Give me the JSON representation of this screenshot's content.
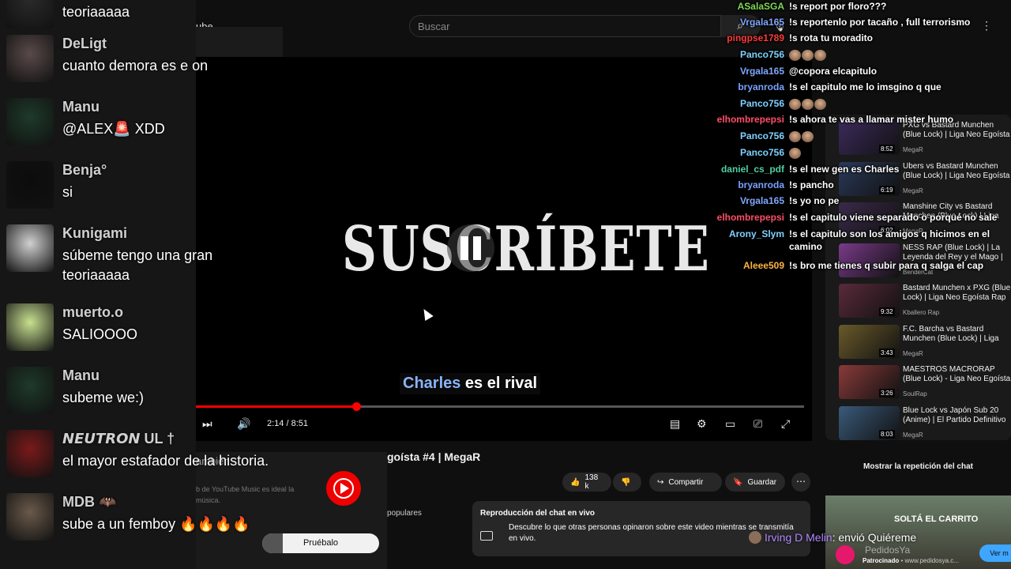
{
  "youtube": {
    "logo_suffix": "ube",
    "search_placeholder": "Buscar",
    "video_title": "goísta #4 | MegaR",
    "time": "2:14 / 8:51",
    "progress_fraction": 0.264,
    "caption_highlight": "Charles",
    "caption_rest": " es el rival",
    "overlay_title": "SUSCRÍBETE",
    "actions": {
      "likes": "138 k",
      "share": "Compartir",
      "save": "Guardar"
    },
    "chip_popular": "populares",
    "live_chat": {
      "title": "Reproducción del chat en vivo",
      "desc": "Descubre lo que otras personas opinaron sobre este video mientras se transmitía en vivo."
    },
    "promo": {
      "text": "ambién",
      "small": "b de YouTube Music es ideal la música.",
      "button": "Pruébalo"
    },
    "related": [
      {
        "title": "PXG vs Bastard Munchen (Blue Lock) | Liga Neo Egoísta #4 |",
        "channel": "MegaR",
        "duration": "8:52",
        "color": "#3b2a5a"
      },
      {
        "title": "Ubers vs Bastard Munchen (Blue Lock) | Liga Neo Egoísta",
        "channel": "MegaR",
        "duration": "6:19",
        "color": "#2a3a5a"
      },
      {
        "title": "Manshine City vs Bastard Munchen (Blue Lock) | Liga",
        "channel": "MegaR",
        "duration": "6:02",
        "color": "#3a2a4a"
      },
      {
        "title": "NESS RAP (Blue Lock) | La Leyenda del Rey y el Mago |",
        "channel": "BenderCat",
        "duration": "",
        "color": "#7a3a8a"
      },
      {
        "title": "Bastard Munchen x PXG (Blue Lock) | Liga Neo Egoísta Rap",
        "channel": "Kballero Rap",
        "duration": "9:32",
        "color": "#5a2a3a"
      },
      {
        "title": "F.C. Barcha vs Bastard Munchen (Blue Lock) | Liga",
        "channel": "MegaR",
        "duration": "3:43",
        "color": "#6a5a2a"
      },
      {
        "title": "MAESTROS MACRORAP (Blue Lock) - Liga Neo Egoísta |",
        "channel": "SoulRap",
        "duration": "3:26",
        "color": "#8a3a3a"
      },
      {
        "title": "Blue Lock vs Japón Sub 20 (Anime) | El Partido Definitivo",
        "channel": "MegaR",
        "duration": "8:03",
        "color": "#3a5a7a"
      }
    ],
    "show_replay": "Mostrar la repetición del chat",
    "ad": {
      "headline": "SOLTÁ EL CARRITO",
      "brand": "PedidosYa",
      "sponsor_label": "Patrocinado",
      "sponsor_url": "www.pedidosya.c...",
      "cta": "Ver m"
    },
    "overlay_chat_title": "PXG vs Bastard Munchen (Blue",
    "overlay_chat_sub": "for you"
  },
  "right_chat": [
    {
      "name": "ASalaSGA",
      "color": "#7ed957",
      "text": "!s report por floro???"
    },
    {
      "name": "Vrgala165",
      "color": "#7fa7ff",
      "text": "!s reportenlo por tacaño , full terrorismo"
    },
    {
      "name": "pingpse1789",
      "color": "#ff3b3b",
      "text": "!s rota tu moradito"
    },
    {
      "name": "Panco756",
      "color": "#7fd1ff",
      "text": "",
      "emotes": 3
    },
    {
      "name": "Vrgala165",
      "color": "#7fa7ff",
      "text": "@copora elcapitulo"
    },
    {
      "name": "bryanroda",
      "color": "#7aa0ff",
      "text": "!s el capitulo me lo imsgino q que"
    },
    {
      "name": "Panco756",
      "color": "#7fd1ff",
      "text": "",
      "emotes": 3
    },
    {
      "name": "elhombrepepsi",
      "color": "#ff4d6a",
      "text": "!s ahora te vas a llamar mister humo"
    },
    {
      "name": "Panco756",
      "color": "#7fd1ff",
      "text": "",
      "emotes": 2
    },
    {
      "name": "Panco756",
      "color": "#7fd1ff",
      "text": "",
      "emotes": 1
    },
    {
      "name": "daniel_cs_pdf",
      "color": "#4dd0a0",
      "text": "!s el new gen es Charles"
    },
    {
      "name": "bryanroda",
      "color": "#7aa0ff",
      "text": "!s pancho"
    },
    {
      "name": "Vrgala165",
      "color": "#7fa7ff",
      "text": "!s yo no pe"
    },
    {
      "name": "elhombrepepsi",
      "color": "#ff4d6a",
      "text": "!s el capitulo viene separado o porqué no sale"
    },
    {
      "name": "Arony_Slym",
      "color": "#7fd1ff",
      "text": "!s el capitulo son los amigos q hicimos en el camino"
    },
    {
      "name": "Aleee509",
      "color": "#ffb347",
      "text": "!s bro me tienes q subir para q salga el cap"
    }
  ],
  "left_chat": [
    {
      "name": "",
      "text": "teoriaaaaa",
      "avatar": "#2a2a2a"
    },
    {
      "name": "DeLigt",
      "text": "cuanto demora es e on",
      "avatar": "#5a4a4a"
    },
    {
      "name": "Manu",
      "text": "@ALEX🚨 XDD",
      "avatar": "#1e3a2a"
    },
    {
      "name": "Benja°",
      "text": "si",
      "avatar": "#0c0c0c"
    },
    {
      "name": "Kunigami",
      "text": "súbeme tengo una gran",
      "text2": "teoriaaaaa",
      "avatar": "#d0d0d0"
    },
    {
      "name": "muerto.o",
      "text": "SALIOOOO",
      "avatar": "#c8e090"
    },
    {
      "name": "Manu",
      "text": "subeme we:)",
      "avatar": "#1e3a2a"
    },
    {
      "name": "𝙉𝙀𝙐𝙏𝙍𝙊𝙉 UL †",
      "text": "el mayor estafador de la historia.",
      "avatar": "#7a1a1a"
    },
    {
      "name": "MDB 🦇",
      "text": "sube a un femboy 🔥🔥🔥🔥",
      "avatar": "#6a5a4a"
    }
  ],
  "irving": {
    "name": "Irving D Melin",
    "text": ": envió Quiéreme"
  }
}
